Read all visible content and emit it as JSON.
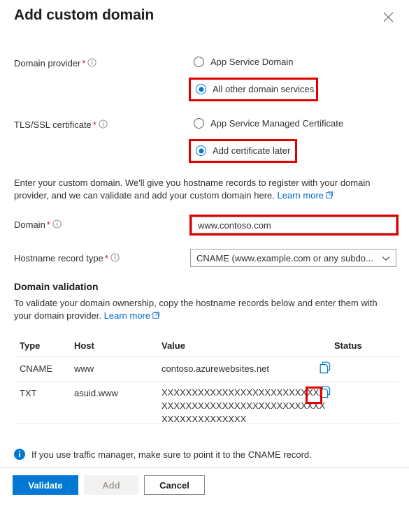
{
  "panel": {
    "title": "Add custom domain",
    "close_icon": "close-icon"
  },
  "fields": {
    "domain_provider": {
      "label": "Domain provider",
      "required_mark": "*",
      "options": [
        {
          "label": "App Service Domain",
          "selected": false
        },
        {
          "label": "All other domain services",
          "selected": true
        }
      ]
    },
    "tls_ssl_certificate": {
      "label": "TLS/SSL certificate",
      "required_mark": "*",
      "options": [
        {
          "label": "App Service Managed Certificate",
          "selected": false
        },
        {
          "label": "Add certificate later",
          "selected": true
        }
      ]
    },
    "domain": {
      "label": "Domain",
      "required_mark": "*",
      "value": "www.contoso.com",
      "placeholder": ""
    },
    "hostname_record_type": {
      "label": "Hostname record type",
      "required_mark": "*",
      "selected": "CNAME (www.example.com or any subdo..."
    }
  },
  "intro": {
    "text": "Enter your custom domain. We'll give you hostname records to register with your domain provider, and we can validate and add your custom domain here.",
    "link_text": "Learn more"
  },
  "validation": {
    "heading": "Domain validation",
    "description": "To validate your domain ownership, copy the hostname records below and enter them with your domain provider.",
    "link_text": "Learn more",
    "table": {
      "columns": [
        "Type",
        "Host",
        "Value",
        "Status"
      ],
      "rows": [
        {
          "type": "CNAME",
          "host": "www",
          "value_lines": [
            "contoso.azurewebsites.net"
          ],
          "status": "",
          "copy_icon": "copy-icon"
        },
        {
          "type": "TXT",
          "host": "asuid.www",
          "value_lines": [
            "XXXXXXXXXXXXXXXXXXXXXXXXXXX",
            "XXXXXXXXXXXXXXXXXXXXXXXXXXX",
            "XXXXXXXXXXXXXX"
          ],
          "status": "",
          "copy_icon": "copy-icon"
        }
      ]
    }
  },
  "notice": {
    "icon": "info-icon",
    "text": "If you use traffic manager, make sure to point it to the CNAME record."
  },
  "footer": {
    "validate_label": "Validate",
    "add_label": "Add",
    "cancel_label": "Cancel"
  },
  "colors": {
    "accent_blue": "#0078d4",
    "link_blue": "#0066cc",
    "required_red": "#a4262c",
    "highlight_red": "#e00000"
  }
}
